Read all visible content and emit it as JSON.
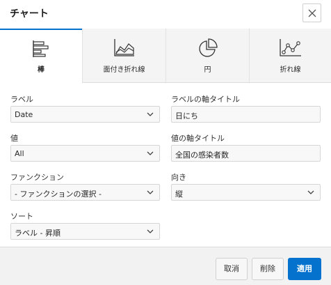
{
  "dialog": {
    "title": "チャート",
    "close_icon": "close-icon"
  },
  "tabs": [
    {
      "label": "棒",
      "icon": "bar-chart-icon",
      "active": true
    },
    {
      "label": "面付き折れ線",
      "icon": "area-chart-icon",
      "active": false
    },
    {
      "label": "円",
      "icon": "pie-chart-icon",
      "active": false
    },
    {
      "label": "折れ線",
      "icon": "line-chart-icon",
      "active": false
    }
  ],
  "form": {
    "label": {
      "label": "ラベル",
      "value": "Date"
    },
    "label_axis_title": {
      "label": "ラベルの軸タイトル",
      "value": "日にち"
    },
    "value": {
      "label": "値",
      "value": "All"
    },
    "value_axis_title": {
      "label": "値の軸タイトル",
      "value": "全国の感染者数"
    },
    "function": {
      "label": "ファンクション",
      "value": "- ファンクションの選択 -"
    },
    "orientation": {
      "label": "向き",
      "value": "縦"
    },
    "sort": {
      "label": "ソート",
      "value": "ラベル - 昇順"
    }
  },
  "footer": {
    "cancel_label": "取消",
    "delete_label": "削除",
    "apply_label": "適用"
  },
  "colors": {
    "accent": "#0572ce"
  }
}
